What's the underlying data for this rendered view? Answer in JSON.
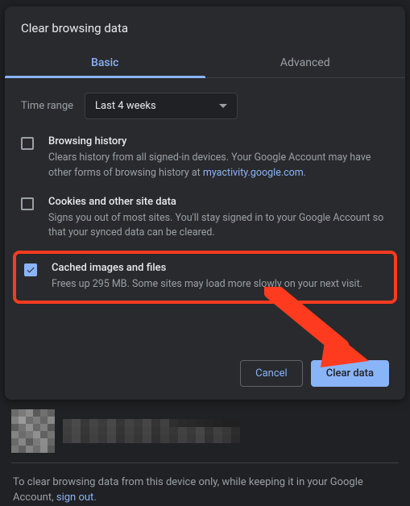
{
  "dialog": {
    "title": "Clear browsing data",
    "tabs": {
      "basic": "Basic",
      "advanced": "Advanced"
    },
    "time_range_label": "Time range",
    "time_range_value": "Last 4 weeks",
    "options": {
      "history": {
        "title": "Browsing history",
        "desc_before": "Clears history from all signed-in devices. Your Google Account may have other forms of browsing history at ",
        "desc_link": "myactivity.google.com",
        "desc_after": ".",
        "checked": false
      },
      "cookies": {
        "title": "Cookies and other site data",
        "desc": "Signs you out of most sites. You'll stay signed in to your Google Account so that your synced data can be cleared.",
        "checked": false
      },
      "cache": {
        "title": "Cached images and files",
        "desc": "Frees up 295 MB. Some sites may load more slowly on your next visit.",
        "checked": true
      }
    },
    "buttons": {
      "cancel": "Cancel",
      "clear": "Clear data"
    }
  },
  "footer": {
    "text_before": "To clear browsing data from this device only, while keeping it in your Google Account, ",
    "link": "sign out",
    "text_after": "."
  },
  "annotation": {
    "arrow_color": "#ff3b1f"
  }
}
